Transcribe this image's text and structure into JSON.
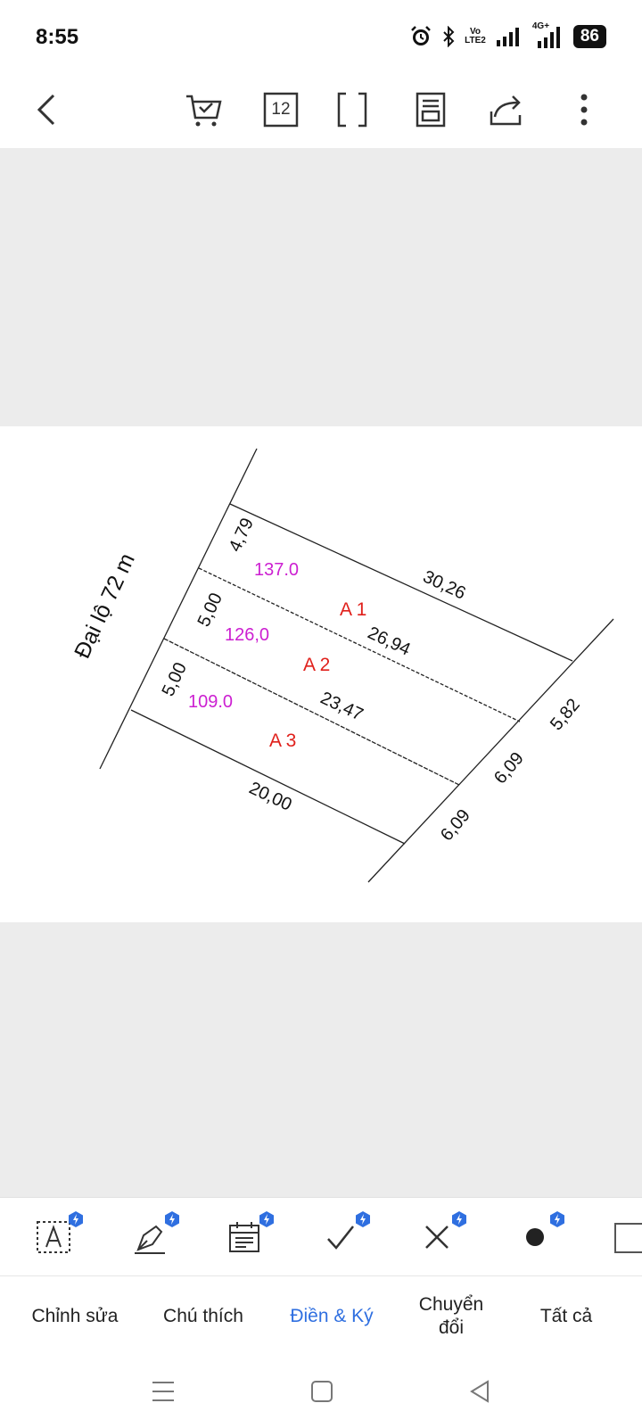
{
  "status": {
    "time": "8:55",
    "battery": "86",
    "network_top": "Vo",
    "network_bottom": "LTE2",
    "signal2_label": "4G+"
  },
  "toolbar": {
    "page_count": "12",
    "icons": [
      "back-icon",
      "cart-check-icon",
      "page-count-icon",
      "fullscreen-icon",
      "page-layout-icon",
      "share-icon",
      "more-icon"
    ]
  },
  "document": {
    "road_label": "Đại lộ 72 m",
    "lots": [
      {
        "name": "A 1",
        "area": "137.0"
      },
      {
        "name": "A 2",
        "area": "126,0"
      },
      {
        "name": "A 3",
        "area": "109.0"
      }
    ],
    "dimensions": {
      "front_a1": "4,79",
      "front_a2": "5,00",
      "front_a3": "5,00",
      "top_length": "30,26",
      "line_a1_a2": "26,94",
      "line_a2_a3": "23,47",
      "bottom_length": "20,00",
      "back_a1": "5,82",
      "back_a2": "6,09",
      "back_a3": "6,09"
    },
    "colors": {
      "lot_name": "#e0201b",
      "area": "#cc1fd1",
      "line": "#222222"
    }
  },
  "bottom_tools": {
    "icons": [
      "text-edit-icon",
      "pen-signature-icon",
      "date-field-icon",
      "checkmark-icon",
      "cross-icon",
      "dot-icon",
      "more-tools-icon"
    ],
    "accent": "#2f6fe0"
  },
  "tabs": [
    {
      "label": "Chỉnh sửa"
    },
    {
      "label": "Chú thích"
    },
    {
      "label": "Điền & Ký"
    },
    {
      "label": "Chuyển\nđổi"
    },
    {
      "label": "Tất cả"
    }
  ]
}
